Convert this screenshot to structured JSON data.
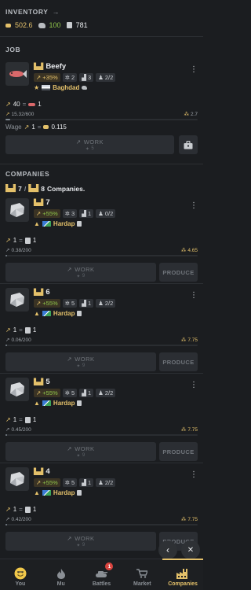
{
  "inventory": {
    "title": "INVENTORY",
    "arrow": "→",
    "gold": "502.6",
    "stone": "100",
    "scrolls": "781"
  },
  "job": {
    "title": "JOB",
    "name": "Beefy",
    "bonus": "+35%",
    "level": "2",
    "workers_icon_value": "3",
    "employees": "2/2",
    "location": "Baghdad",
    "energy": "40",
    "energy_cost": "1",
    "progress_text": "15.32/600",
    "progress_fraction": 0.0255,
    "rate": "2.7",
    "wage_label": "Wage",
    "wage_energy": "1",
    "wage_amount": "0.115",
    "work_label": "WORK",
    "work_sub": "5"
  },
  "companies": {
    "title": "COMPANIES",
    "count_owned": "7",
    "count_max": "8",
    "count_suffix": "Companies.",
    "items": [
      {
        "name": "7",
        "bonus": "+55%",
        "level": "3",
        "workers": "1",
        "employees": "0/2",
        "location": "Hardap",
        "output_energy": "1",
        "output_amount": "1",
        "progress_text": "0.38/200",
        "progress_fraction": 0.0019,
        "rate": "4.65",
        "work_label": "WORK",
        "work_sub": "9",
        "produce_label": "PRODUCE"
      },
      {
        "name": "6",
        "bonus": "+55%",
        "level": "5",
        "workers": "1",
        "employees": "2/2",
        "location": "Hardap",
        "output_energy": "1",
        "output_amount": "1",
        "progress_text": "0.06/200",
        "progress_fraction": 0.0003,
        "rate": "7.75",
        "work_label": "WORK",
        "work_sub": "9",
        "produce_label": "PRODUCE"
      },
      {
        "name": "5",
        "bonus": "+55%",
        "level": "5",
        "workers": "1",
        "employees": "2/2",
        "location": "Hardap",
        "output_energy": "1",
        "output_amount": "1",
        "progress_text": "0.45/200",
        "progress_fraction": 0.0023,
        "rate": "7.75",
        "work_label": "WORK",
        "work_sub": "9",
        "produce_label": "PRODUCE"
      },
      {
        "name": "4",
        "bonus": "+55%",
        "level": "5",
        "workers": "1",
        "employees": "2/2",
        "location": "Hardap",
        "output_energy": "1",
        "output_amount": "1",
        "progress_text": "0.42/200",
        "progress_fraction": 0.0021,
        "rate": "7.75",
        "work_label": "WORK",
        "work_sub": "9",
        "produce_label": "PRODUCE"
      }
    ]
  },
  "nav": {
    "items": [
      {
        "label": "You",
        "icon": "smiley-icon"
      },
      {
        "label": "Mu",
        "icon": "flame-icon"
      },
      {
        "label": "Battles",
        "icon": "tank-icon",
        "badge": "1"
      },
      {
        "label": "Market",
        "icon": "cart-icon"
      },
      {
        "label": "Companies",
        "icon": "factory-icon"
      }
    ],
    "active": "Companies"
  },
  "fab": {
    "back": "‹",
    "close": "✕"
  },
  "colors": {
    "background": "#1b1d20",
    "accent": "#e3c06a",
    "bonus_green": "#8fc54a",
    "badge": "#d9443f"
  }
}
